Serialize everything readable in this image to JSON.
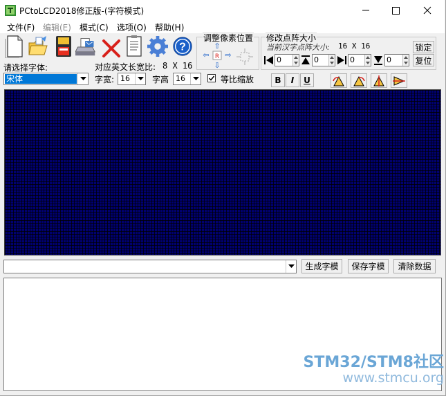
{
  "window": {
    "title": "PCtoLCD2018修正版-(字符模式)",
    "controls": {
      "minimize": "—",
      "maximize": "☐",
      "close": "✕"
    }
  },
  "menu": [
    {
      "label": "文件(F)",
      "enabled": true
    },
    {
      "label": "编辑(E)",
      "enabled": false
    },
    {
      "label": "模式(C)",
      "enabled": true
    },
    {
      "label": "选项(O)",
      "enabled": true
    },
    {
      "label": "帮助(H)",
      "enabled": true
    }
  ],
  "toolbar": {
    "icons": [
      "new-file-icon",
      "open-folder-icon",
      "save-disk-icon",
      "print-icon",
      "delete-icon",
      "notes-icon",
      "settings-gear-icon",
      "help-icon"
    ]
  },
  "pixel_position": {
    "group_title": "调整像素位置",
    "arrow_up": "⇧",
    "arrow_left": "⇦",
    "arrow_right": "⇨",
    "arrow_down": "⇩",
    "reset": "R"
  },
  "dot_size": {
    "group_title": "修改点阵大小",
    "current_label": "当前汉字点阵大小:",
    "current_value": "16 X 16",
    "spin_values": [
      "0",
      "0",
      "0",
      "0"
    ],
    "lock_button": "锁定",
    "reset_button": "复位"
  },
  "font": {
    "select_label": "请选择字体:",
    "selected_font": "宋体",
    "ratio_label": "对应英文长宽比:",
    "ratio_value": "8 X 16",
    "width_label": "字宽:",
    "width_value": "16",
    "height_label": "字高",
    "height_value": "16",
    "proportional_label": "等比缩放",
    "proportional_checked": true
  },
  "format_buttons": {
    "bold": "B",
    "italic": "I",
    "underline": "U"
  },
  "rotate_buttons": [
    "rotate-left-icon",
    "rotate-right-icon",
    "flip-vertical-icon",
    "flip-horizontal-icon"
  ],
  "canvas": {
    "background": "#000070",
    "grid_color": "#000000"
  },
  "bottom": {
    "input_value": "",
    "generate_button": "生成字模",
    "save_button": "保存字模",
    "clear_button": "清除数据"
  },
  "output_text": "",
  "watermark": {
    "line1": "STM32/STM8社区",
    "line2": "www.stmcu.org"
  }
}
